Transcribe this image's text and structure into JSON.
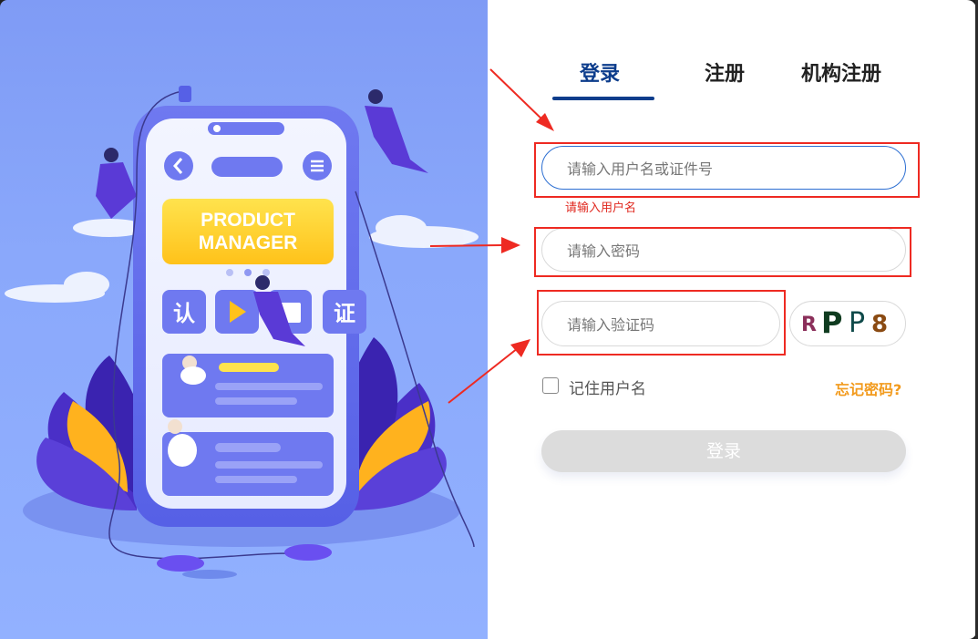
{
  "illustration": {
    "phone_banner_line1": "PRODUCT",
    "phone_banner_line2": "MANAGER",
    "button_left": "认",
    "button_right": "证"
  },
  "tabs": [
    {
      "label": "登录",
      "active": true
    },
    {
      "label": "注册",
      "active": false
    },
    {
      "label": "机构注册",
      "active": false
    }
  ],
  "form": {
    "username_placeholder": "请输入用户名或证件号",
    "username_error": "请输入用户名",
    "password_placeholder": "请输入密码",
    "captcha_placeholder": "请输入验证码",
    "captcha_chars": [
      {
        "ch": "R",
        "color": "#8b2f5a"
      },
      {
        "ch": "P",
        "color": "#0f3b1f"
      },
      {
        "ch": "P",
        "color": "#0f4a4a"
      },
      {
        "ch": "8",
        "color": "#8a4a12"
      }
    ],
    "remember_label": "记住用户名",
    "remember_checked": false,
    "forgot_label": "忘记密码?",
    "submit_label": "登录"
  },
  "colors": {
    "accent": "#0d3d8c",
    "error": "#e0281f",
    "forgot": "#f29a1c",
    "annotation_red": "#ee2a22"
  }
}
